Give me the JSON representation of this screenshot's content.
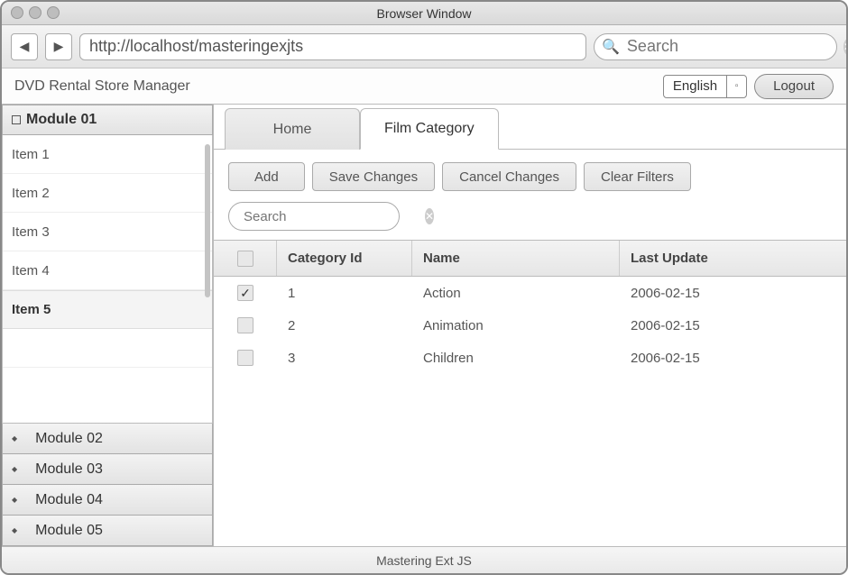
{
  "window": {
    "title": "Browser Window"
  },
  "url_bar": {
    "url": "http://localhost/masteringexjts",
    "search_placeholder": "Search"
  },
  "app_header": {
    "title": "DVD Rental Store Manager",
    "language": "English",
    "logout": "Logout"
  },
  "sidebar": {
    "module_active": "Module 01",
    "items": [
      "Item 1",
      "Item 2",
      "Item 3",
      "Item 4",
      "Item 5"
    ],
    "selected_index": 4,
    "collapsed_modules": [
      "Module 02",
      "Module 03",
      "Module 04",
      "Module 05"
    ]
  },
  "tabs": {
    "items": [
      "Home",
      "Film Category"
    ],
    "active_index": 1
  },
  "toolbar": {
    "add": "Add",
    "save": "Save Changes",
    "cancel": "Cancel Changes",
    "clear": "Clear Filters"
  },
  "table_search": {
    "placeholder": "Search"
  },
  "grid": {
    "columns": {
      "check": "",
      "id": "Category Id",
      "name": "Name",
      "last_update": "Last Update"
    },
    "rows": [
      {
        "checked": true,
        "id": "1",
        "name": "Action",
        "last_update": "2006-02-15"
      },
      {
        "checked": false,
        "id": "2",
        "name": "Animation",
        "last_update": "2006-02-15"
      },
      {
        "checked": false,
        "id": "3",
        "name": "Children",
        "last_update": "2006-02-15"
      }
    ]
  },
  "footer": {
    "text": "Mastering Ext JS"
  }
}
